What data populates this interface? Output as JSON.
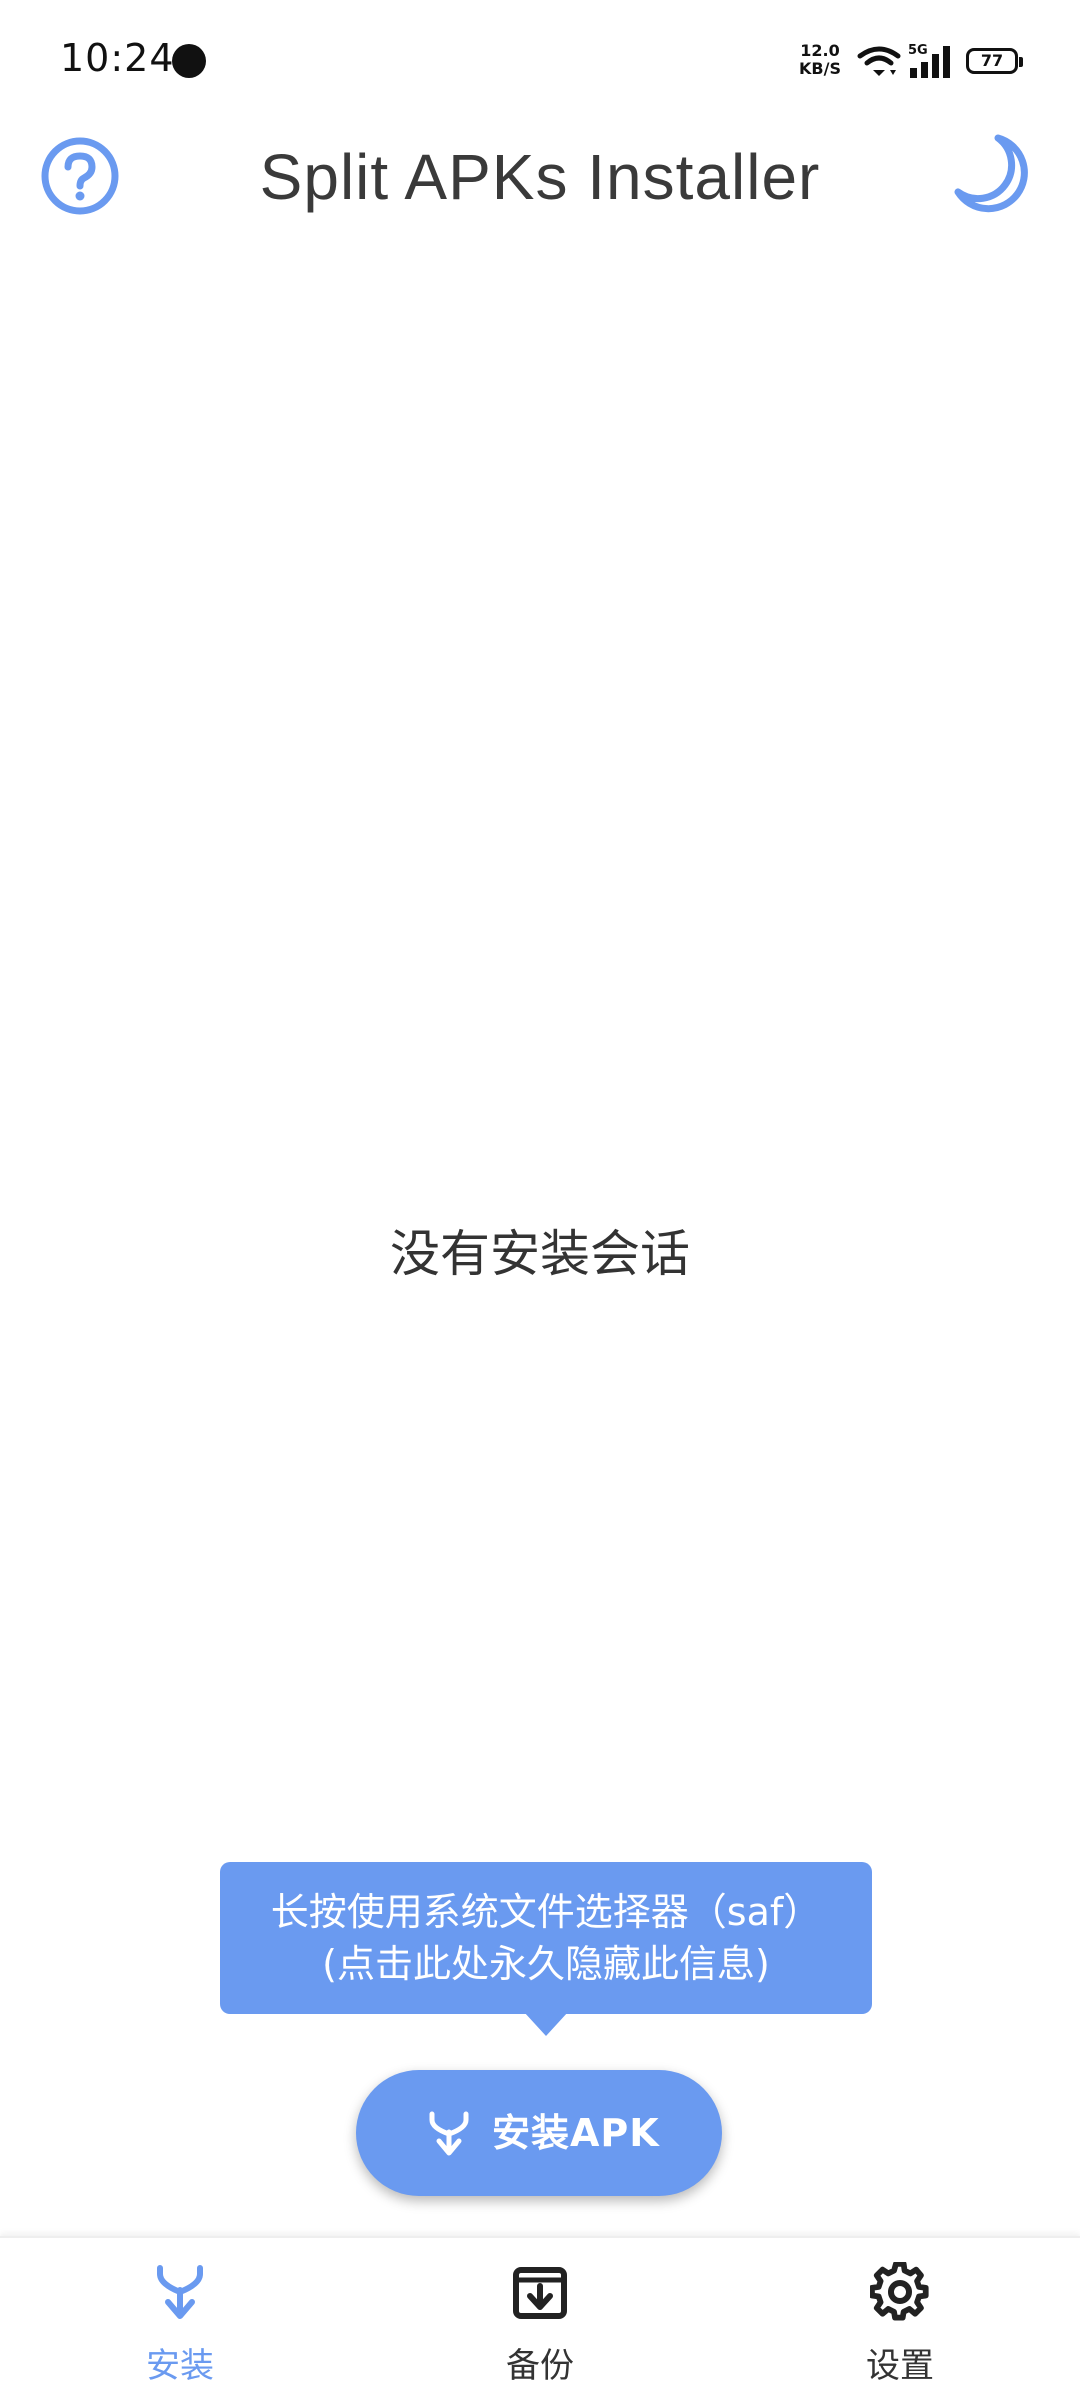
{
  "status_bar": {
    "time": "10:24",
    "net_speed_value": "12.0",
    "net_speed_unit": "KB/S",
    "signal_label": "5G",
    "battery_level": "77"
  },
  "app_bar": {
    "title": "Split APKs Installer",
    "help_icon": "help-circle-icon",
    "theme_icon": "moon-icon"
  },
  "main": {
    "empty_message": "没有安装会话"
  },
  "tooltip": {
    "line1": "长按使用系统文件选择器（saf）",
    "line2": "(点击此处永久隐藏此信息)"
  },
  "fab": {
    "label": "安装APK",
    "icon": "merge-arrow-icon"
  },
  "bottom_nav": {
    "items": [
      {
        "label": "安装",
        "icon": "install-icon",
        "active": true
      },
      {
        "label": "备份",
        "icon": "backup-icon",
        "active": false
      },
      {
        "label": "设置",
        "icon": "gear-icon",
        "active": false
      }
    ]
  },
  "colors": {
    "accent": "#6a9af0",
    "text": "#333333",
    "background": "#ffffff"
  }
}
